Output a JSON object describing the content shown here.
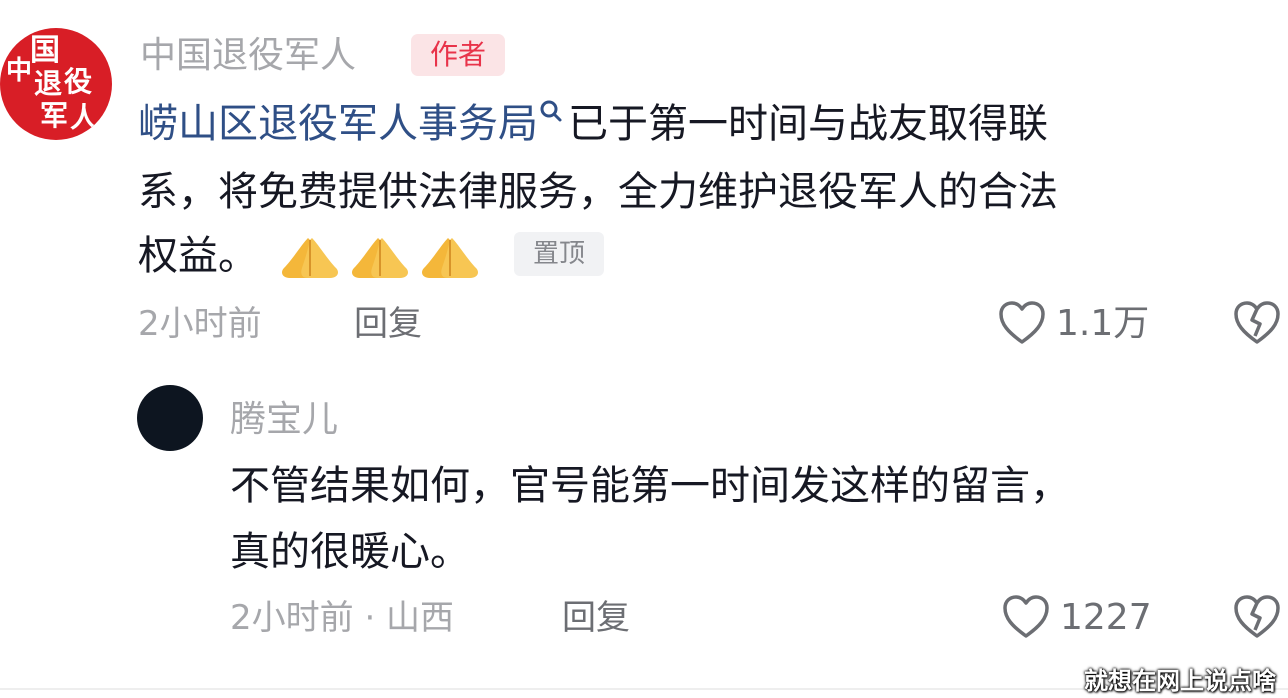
{
  "post": {
    "avatar_text": [
      "中国",
      "退役",
      "军人"
    ],
    "username": "中国退役军人",
    "author_badge": "作者",
    "link_text": "崂山区退役军人事务局",
    "text_line1_rest": "已于第一时间与战友取得联",
    "text_line2": "系，将免费提供法律服务，全力维护退役军人的合法",
    "text_line3": "权益。",
    "emoji": "pray-hands-icon",
    "pin_badge": "置顶",
    "time": "2小时前",
    "reply_label": "回复",
    "like_count": "1.1万"
  },
  "reply": {
    "username": "腾宝儿",
    "text_line1": "不管结果如何，官号能第一时间发这样的留言，",
    "text_line2": "真的很暖心。",
    "time_location": "2小时前 · 山西",
    "reply_label": "回复",
    "like_count": "1227"
  },
  "watermark": "就想在网上说点啥",
  "colors": {
    "brand_red": "#d81e26",
    "link_blue": "#2f4f86",
    "meta_gray": "#a6a7ab"
  }
}
